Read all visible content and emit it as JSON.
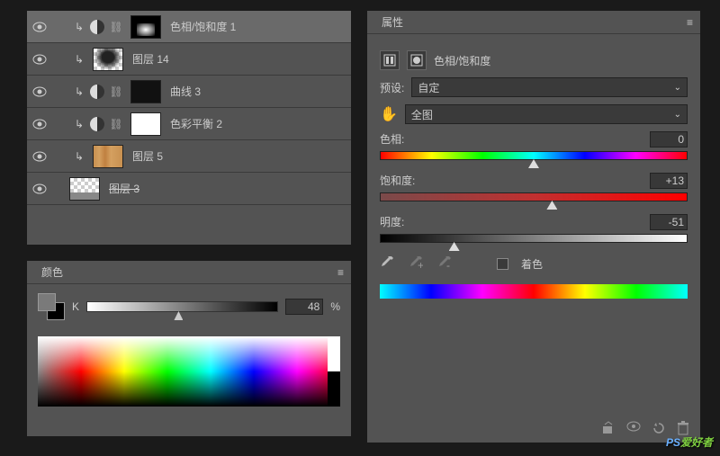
{
  "layers": {
    "items": [
      {
        "name": "色相/饱和度 1",
        "thumb": "fire",
        "selected": true,
        "hasAdj": true
      },
      {
        "name": "图层 14",
        "thumb": "smoke",
        "hasAdj": false
      },
      {
        "name": "曲线 3",
        "thumb": "mask-dark",
        "hasAdj": true
      },
      {
        "name": "色彩平衡 2",
        "thumb": "white",
        "hasAdj": true
      },
      {
        "name": "图层 5",
        "thumb": "wood",
        "hasAdj": false
      },
      {
        "name": "图层 3",
        "thumb": "trans",
        "hasAdj": false,
        "noIndent": true
      }
    ]
  },
  "colorPanel": {
    "title": "颜色",
    "channel": "K",
    "value": "48",
    "unit": "%",
    "knobPos": 48
  },
  "props": {
    "title": "属性",
    "adjustmentName": "色相/饱和度",
    "presetLabel": "预设:",
    "presetValue": "自定",
    "rangeValue": "全图",
    "hue": {
      "label": "色相:",
      "value": "0",
      "pos": 50
    },
    "sat": {
      "label": "饱和度:",
      "value": "+13",
      "pos": 56
    },
    "light": {
      "label": "明度:",
      "value": "-51",
      "pos": 24
    },
    "colorize": "着色"
  },
  "watermark": {
    "ps": "PS",
    "rest": "爱好者"
  }
}
